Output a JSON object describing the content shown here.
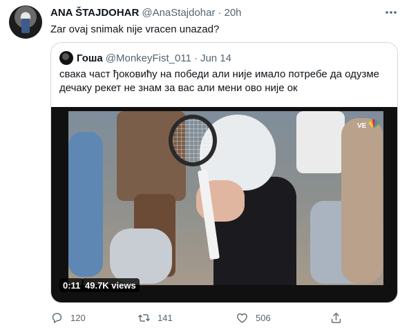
{
  "tweet": {
    "author_name": "ANA ŠTAJDOHAR",
    "author_handle": "@AnaStajdohar",
    "separator": "·",
    "time": "20h",
    "text": "Zar ovaj snimak nije vracen unazad?"
  },
  "quoted_tweet": {
    "author_name": "Гоша",
    "author_handle": "@MonkeyFist_011",
    "separator": "·",
    "time": "Jun 14",
    "text": "свака част ђоковићу на победи али није имало потребе да одузме дечаку рекет не знам за вас али мени ово није ок"
  },
  "video": {
    "duration": "0:11",
    "views": "49.7K views",
    "broadcast_label": "VE"
  },
  "actions": {
    "replies": "120",
    "retweets": "141",
    "likes": "506"
  },
  "icons": {
    "more": "more-options-icon",
    "reply": "reply-icon",
    "retweet": "retweet-icon",
    "like": "heart-icon",
    "share": "share-icon"
  },
  "colors": {
    "text_primary": "#0f1419",
    "text_secondary": "#536471",
    "border": "#cfd9de"
  }
}
